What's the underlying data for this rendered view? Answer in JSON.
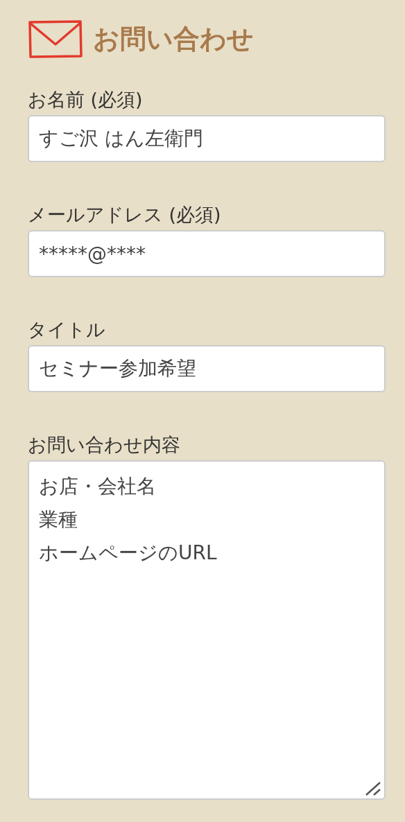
{
  "heading": {
    "title": "お問い合わせ"
  },
  "fields": [
    {
      "kind": "input",
      "label": "お名前 (必須)",
      "value": "すご沢 はん左衛門"
    },
    {
      "kind": "input",
      "label": "メールアドレス (必須)",
      "value": "*****@****"
    },
    {
      "kind": "input",
      "label": "タイトル",
      "value": "セミナー参加希望"
    },
    {
      "kind": "textarea",
      "label": "お問い合わせ内容",
      "lines": [
        "お店・会社名",
        "業種",
        "ホームページのURL"
      ]
    }
  ]
}
